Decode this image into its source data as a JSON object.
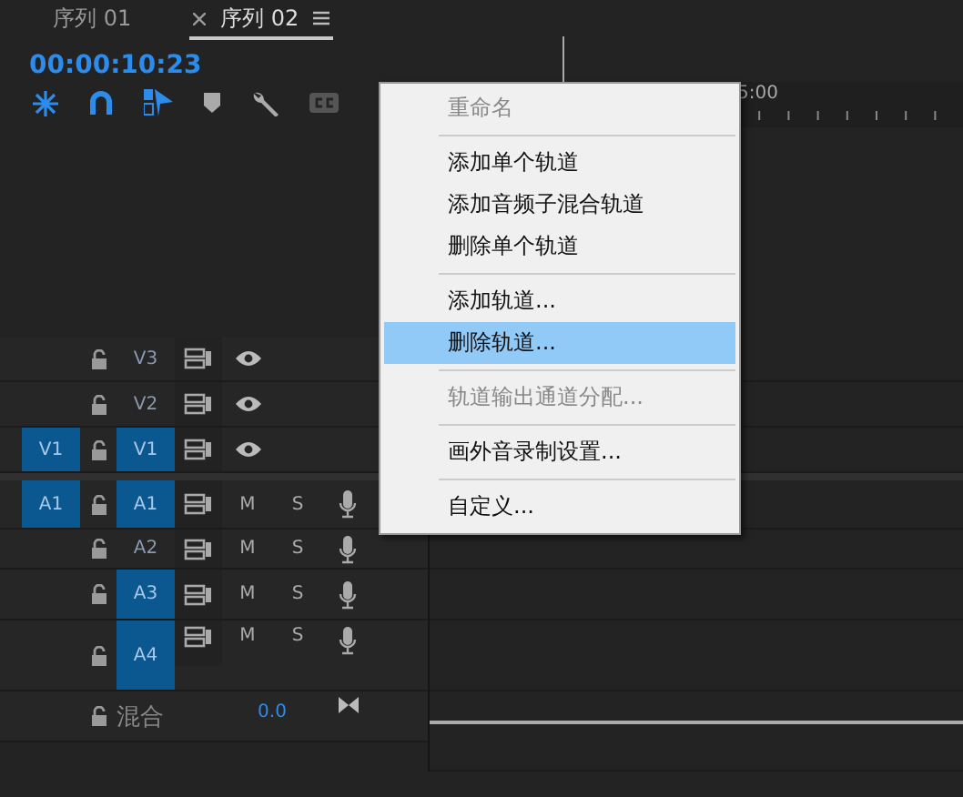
{
  "tabs": [
    {
      "label": "序列 01",
      "selected": false
    },
    {
      "label": "序列 02",
      "selected": true
    }
  ],
  "timecode": "00:00:10:23",
  "ruler": {
    "label": "5:00"
  },
  "tracks": [
    {
      "kind": "video",
      "name": "V3",
      "target_selected": false
    },
    {
      "kind": "video",
      "name": "V2",
      "target_selected": false
    },
    {
      "kind": "video",
      "source": "V1",
      "name": "V1",
      "target_selected": true
    },
    {
      "kind": "audio",
      "source": "A1",
      "name": "A1",
      "target_selected": true,
      "mute": "M",
      "solo": "S"
    },
    {
      "kind": "audio",
      "name": "A2",
      "target_selected": false,
      "mute": "M",
      "solo": "S"
    },
    {
      "kind": "audio",
      "name": "A3",
      "target_selected": true,
      "mute": "M",
      "solo": "S"
    },
    {
      "kind": "audio",
      "name": "A4",
      "target_selected": true,
      "mute": "M",
      "solo": "S"
    }
  ],
  "mix": {
    "label": "混合",
    "value": "0.0"
  },
  "menu": [
    {
      "kind": "item",
      "label": "重命名",
      "disabled": true,
      "selected": false
    },
    {
      "kind": "separator"
    },
    {
      "kind": "item",
      "label": "添加单个轨道",
      "disabled": false,
      "selected": false
    },
    {
      "kind": "item",
      "label": "添加音频子混合轨道",
      "disabled": false,
      "selected": false
    },
    {
      "kind": "item",
      "label": "删除单个轨道",
      "disabled": false,
      "selected": false
    },
    {
      "kind": "separator"
    },
    {
      "kind": "item",
      "label": "添加轨道...",
      "disabled": false,
      "selected": false
    },
    {
      "kind": "item",
      "label": "删除轨道...",
      "disabled": false,
      "selected": true
    },
    {
      "kind": "separator"
    },
    {
      "kind": "item",
      "label": "轨道输出通道分配...",
      "disabled": true,
      "selected": false
    },
    {
      "kind": "separator"
    },
    {
      "kind": "item",
      "label": "画外音录制设置...",
      "disabled": false,
      "selected": false
    },
    {
      "kind": "separator"
    },
    {
      "kind": "item",
      "label": "自定义...",
      "disabled": false,
      "selected": false
    }
  ]
}
